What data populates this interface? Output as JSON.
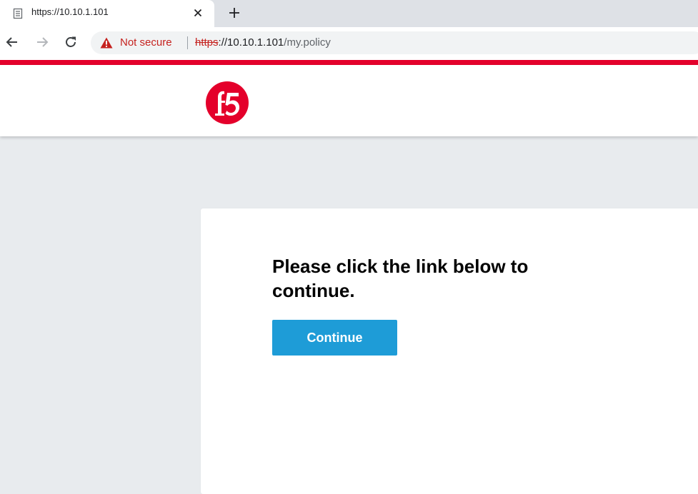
{
  "browser": {
    "tab": {
      "title": "https://10.10.1.101",
      "favicon": "page-icon",
      "close_icon": "close-icon"
    },
    "new_tab_icon": "plus-icon",
    "nav": {
      "back_icon": "arrow-left-icon",
      "forward_icon": "arrow-right-icon",
      "reload_icon": "reload-icon"
    },
    "omnibox": {
      "security_icon": "warning-triangle-icon",
      "security_label": "Not secure",
      "url_scheme": "https",
      "url_rest": "://10.10.1.101",
      "url_path": "/my.policy"
    }
  },
  "site": {
    "logo": "f5-logo",
    "accent_color": "#e4002b"
  },
  "card": {
    "heading": "Please click the link below to continue.",
    "button_label": "Continue",
    "button_color": "#1e9cd7"
  }
}
